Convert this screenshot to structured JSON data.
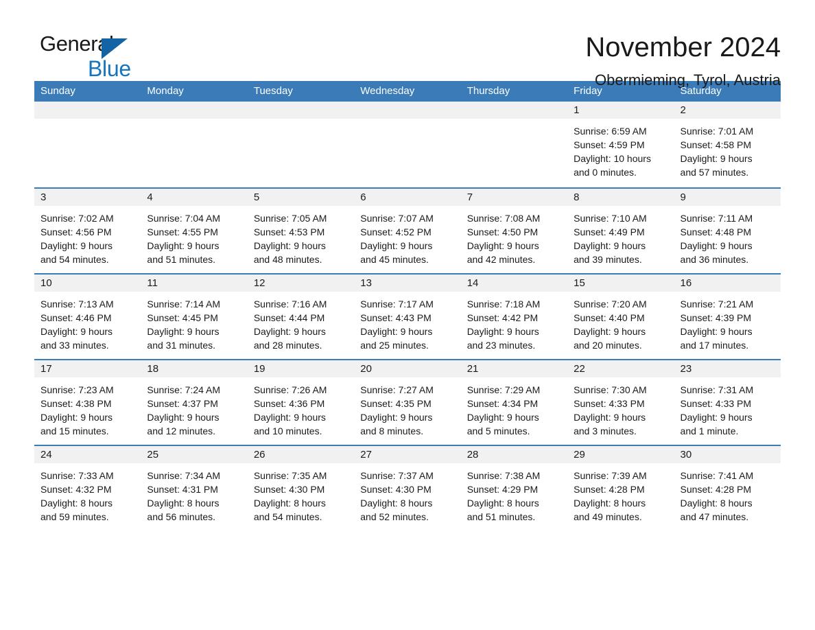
{
  "brand": {
    "name_part1": "General",
    "name_part2": "Blue",
    "accent_color": "#1574bd",
    "triangle_color": "#1463a5"
  },
  "header": {
    "month_title": "November 2024",
    "location": "Obermieming, Tyrol, Austria",
    "header_bg_color": "#3b7cb8",
    "day_strip_color": "#f1f1f1"
  },
  "weekdays": [
    "Sunday",
    "Monday",
    "Tuesday",
    "Wednesday",
    "Thursday",
    "Friday",
    "Saturday"
  ],
  "weeks": [
    [
      {
        "day": "",
        "lines": []
      },
      {
        "day": "",
        "lines": []
      },
      {
        "day": "",
        "lines": []
      },
      {
        "day": "",
        "lines": []
      },
      {
        "day": "",
        "lines": []
      },
      {
        "day": "1",
        "lines": [
          "Sunrise: 6:59 AM",
          "Sunset: 4:59 PM",
          "Daylight: 10 hours",
          "and 0 minutes."
        ]
      },
      {
        "day": "2",
        "lines": [
          "Sunrise: 7:01 AM",
          "Sunset: 4:58 PM",
          "Daylight: 9 hours",
          "and 57 minutes."
        ]
      }
    ],
    [
      {
        "day": "3",
        "lines": [
          "Sunrise: 7:02 AM",
          "Sunset: 4:56 PM",
          "Daylight: 9 hours",
          "and 54 minutes."
        ]
      },
      {
        "day": "4",
        "lines": [
          "Sunrise: 7:04 AM",
          "Sunset: 4:55 PM",
          "Daylight: 9 hours",
          "and 51 minutes."
        ]
      },
      {
        "day": "5",
        "lines": [
          "Sunrise: 7:05 AM",
          "Sunset: 4:53 PM",
          "Daylight: 9 hours",
          "and 48 minutes."
        ]
      },
      {
        "day": "6",
        "lines": [
          "Sunrise: 7:07 AM",
          "Sunset: 4:52 PM",
          "Daylight: 9 hours",
          "and 45 minutes."
        ]
      },
      {
        "day": "7",
        "lines": [
          "Sunrise: 7:08 AM",
          "Sunset: 4:50 PM",
          "Daylight: 9 hours",
          "and 42 minutes."
        ]
      },
      {
        "day": "8",
        "lines": [
          "Sunrise: 7:10 AM",
          "Sunset: 4:49 PM",
          "Daylight: 9 hours",
          "and 39 minutes."
        ]
      },
      {
        "day": "9",
        "lines": [
          "Sunrise: 7:11 AM",
          "Sunset: 4:48 PM",
          "Daylight: 9 hours",
          "and 36 minutes."
        ]
      }
    ],
    [
      {
        "day": "10",
        "lines": [
          "Sunrise: 7:13 AM",
          "Sunset: 4:46 PM",
          "Daylight: 9 hours",
          "and 33 minutes."
        ]
      },
      {
        "day": "11",
        "lines": [
          "Sunrise: 7:14 AM",
          "Sunset: 4:45 PM",
          "Daylight: 9 hours",
          "and 31 minutes."
        ]
      },
      {
        "day": "12",
        "lines": [
          "Sunrise: 7:16 AM",
          "Sunset: 4:44 PM",
          "Daylight: 9 hours",
          "and 28 minutes."
        ]
      },
      {
        "day": "13",
        "lines": [
          "Sunrise: 7:17 AM",
          "Sunset: 4:43 PM",
          "Daylight: 9 hours",
          "and 25 minutes."
        ]
      },
      {
        "day": "14",
        "lines": [
          "Sunrise: 7:18 AM",
          "Sunset: 4:42 PM",
          "Daylight: 9 hours",
          "and 23 minutes."
        ]
      },
      {
        "day": "15",
        "lines": [
          "Sunrise: 7:20 AM",
          "Sunset: 4:40 PM",
          "Daylight: 9 hours",
          "and 20 minutes."
        ]
      },
      {
        "day": "16",
        "lines": [
          "Sunrise: 7:21 AM",
          "Sunset: 4:39 PM",
          "Daylight: 9 hours",
          "and 17 minutes."
        ]
      }
    ],
    [
      {
        "day": "17",
        "lines": [
          "Sunrise: 7:23 AM",
          "Sunset: 4:38 PM",
          "Daylight: 9 hours",
          "and 15 minutes."
        ]
      },
      {
        "day": "18",
        "lines": [
          "Sunrise: 7:24 AM",
          "Sunset: 4:37 PM",
          "Daylight: 9 hours",
          "and 12 minutes."
        ]
      },
      {
        "day": "19",
        "lines": [
          "Sunrise: 7:26 AM",
          "Sunset: 4:36 PM",
          "Daylight: 9 hours",
          "and 10 minutes."
        ]
      },
      {
        "day": "20",
        "lines": [
          "Sunrise: 7:27 AM",
          "Sunset: 4:35 PM",
          "Daylight: 9 hours",
          "and 8 minutes."
        ]
      },
      {
        "day": "21",
        "lines": [
          "Sunrise: 7:29 AM",
          "Sunset: 4:34 PM",
          "Daylight: 9 hours",
          "and 5 minutes."
        ]
      },
      {
        "day": "22",
        "lines": [
          "Sunrise: 7:30 AM",
          "Sunset: 4:33 PM",
          "Daylight: 9 hours",
          "and 3 minutes."
        ]
      },
      {
        "day": "23",
        "lines": [
          "Sunrise: 7:31 AM",
          "Sunset: 4:33 PM",
          "Daylight: 9 hours",
          "and 1 minute."
        ]
      }
    ],
    [
      {
        "day": "24",
        "lines": [
          "Sunrise: 7:33 AM",
          "Sunset: 4:32 PM",
          "Daylight: 8 hours",
          "and 59 minutes."
        ]
      },
      {
        "day": "25",
        "lines": [
          "Sunrise: 7:34 AM",
          "Sunset: 4:31 PM",
          "Daylight: 8 hours",
          "and 56 minutes."
        ]
      },
      {
        "day": "26",
        "lines": [
          "Sunrise: 7:35 AM",
          "Sunset: 4:30 PM",
          "Daylight: 8 hours",
          "and 54 minutes."
        ]
      },
      {
        "day": "27",
        "lines": [
          "Sunrise: 7:37 AM",
          "Sunset: 4:30 PM",
          "Daylight: 8 hours",
          "and 52 minutes."
        ]
      },
      {
        "day": "28",
        "lines": [
          "Sunrise: 7:38 AM",
          "Sunset: 4:29 PM",
          "Daylight: 8 hours",
          "and 51 minutes."
        ]
      },
      {
        "day": "29",
        "lines": [
          "Sunrise: 7:39 AM",
          "Sunset: 4:28 PM",
          "Daylight: 8 hours",
          "and 49 minutes."
        ]
      },
      {
        "day": "30",
        "lines": [
          "Sunrise: 7:41 AM",
          "Sunset: 4:28 PM",
          "Daylight: 8 hours",
          "and 47 minutes."
        ]
      }
    ]
  ]
}
